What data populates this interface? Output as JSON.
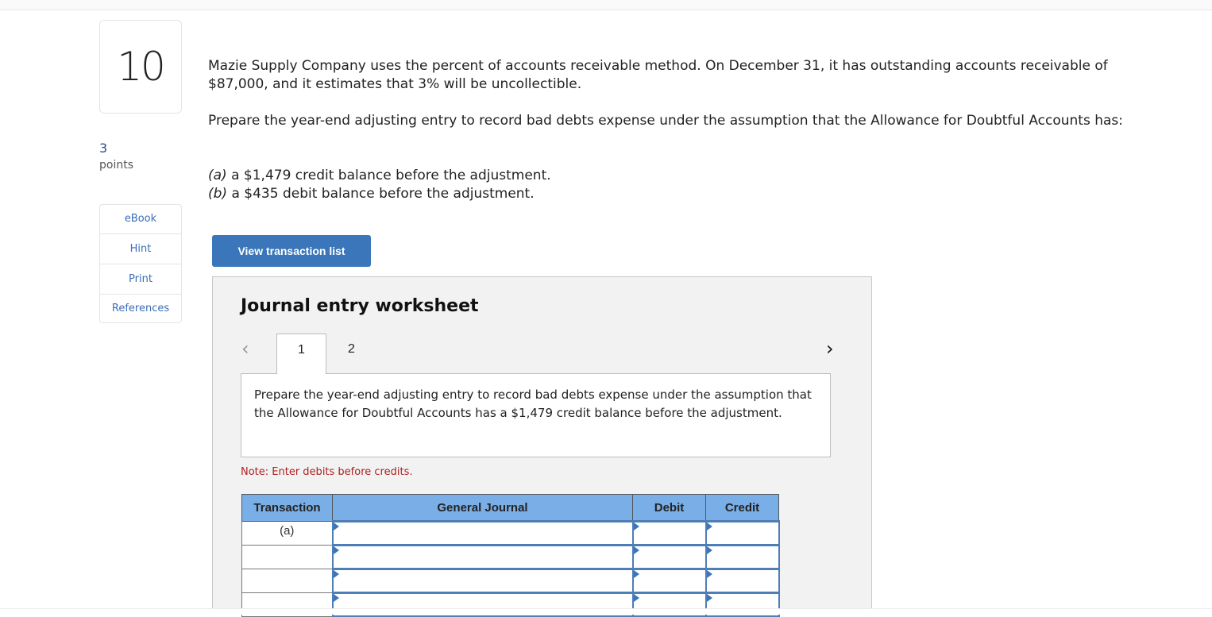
{
  "question": {
    "number": "10",
    "points_value": "3",
    "points_label": "points",
    "paragraph1": "Mazie Supply Company uses the percent of accounts receivable method. On December 31, it has outstanding accounts receivable of $87,000, and it estimates that 3% will be uncollectible.",
    "paragraph2": "Prepare the year-end adjusting entry to record bad debts expense under the assumption that the Allowance for Doubtful Accounts has:",
    "parts": [
      {
        "letter": "(a)",
        "text": " a $1,479 credit balance before the adjustment."
      },
      {
        "letter": "(b)",
        "text": " a $435 debit balance before the adjustment."
      }
    ]
  },
  "sidebar": {
    "links": [
      {
        "label": "eBook"
      },
      {
        "label": "Hint"
      },
      {
        "label": "Print"
      },
      {
        "label": "References"
      }
    ]
  },
  "toolbar": {
    "view_transaction_list_label": "View transaction list"
  },
  "worksheet": {
    "title": "Journal entry worksheet",
    "prev_icon": "‹",
    "next_icon": "›",
    "tabs": [
      {
        "label": "1",
        "active": true
      },
      {
        "label": "2",
        "active": false
      }
    ],
    "instruction": "Prepare the year-end adjusting entry to record bad debts expense under the assumption that the Allowance for Doubtful Accounts has a $1,479 credit balance before the adjustment.",
    "note": "Note: Enter debits before credits.",
    "table": {
      "headers": [
        "Transaction",
        "General Journal",
        "Debit",
        "Credit"
      ],
      "rows": [
        {
          "transaction": "(a)",
          "account": "",
          "debit": "",
          "credit": ""
        },
        {
          "transaction": "",
          "account": "",
          "debit": "",
          "credit": ""
        },
        {
          "transaction": "",
          "account": "",
          "debit": "",
          "credit": ""
        },
        {
          "transaction": "",
          "account": "",
          "debit": "",
          "credit": ""
        }
      ]
    }
  },
  "colors": {
    "accent_button": "#3a76b9",
    "table_header": "#7aaee6",
    "note_red": "#b12020",
    "link_blue": "#3b6db5"
  }
}
